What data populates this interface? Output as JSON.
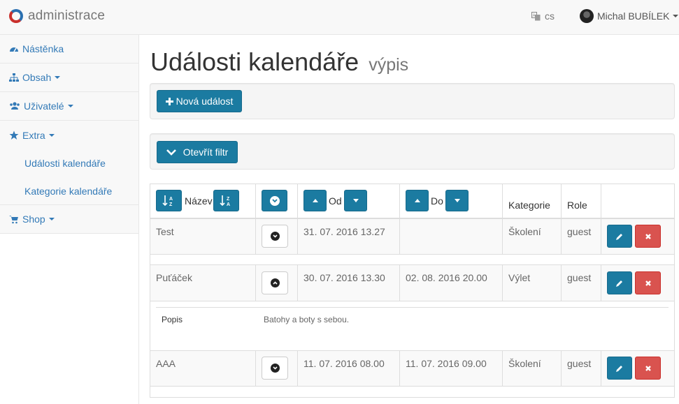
{
  "topbar": {
    "brand": "administrace",
    "language": "cs",
    "user": "Michal BUBÍLEK"
  },
  "sidebar": {
    "items": [
      {
        "label": "Nástěnka",
        "icon": "dashboard-icon"
      },
      {
        "label": "Obsah",
        "icon": "sitemap-icon"
      },
      {
        "label": "Uživatelé",
        "icon": "users-icon"
      },
      {
        "label": "Extra",
        "icon": "star-icon"
      }
    ],
    "extra_sub": [
      "Události kalendáře",
      "Kategorie kalendáře"
    ],
    "shop": {
      "label": "Shop",
      "icon": "cart-icon"
    }
  },
  "page": {
    "title": "Události kalendáře",
    "subtitle": "výpis"
  },
  "toolbar": {
    "new_event_label": "Nová událost",
    "open_filter_label": "Otevřít filtr"
  },
  "table": {
    "headers": {
      "name": "Název",
      "from": "Od",
      "to": "Do",
      "category": "Kategorie",
      "role": "Role"
    },
    "rows": [
      {
        "name": "Test",
        "from": "31. 07. 2016 13.27",
        "to": "",
        "category": "Školení",
        "role": "guest",
        "expanded": false
      },
      {
        "name": "Puťáček",
        "from": "30. 07. 2016 13.30",
        "to": "02. 08. 2016 20.00",
        "category": "Výlet",
        "role": "guest",
        "expanded": true
      },
      {
        "name": "AAA",
        "from": "11. 07. 2016 08.00",
        "to": "11. 07. 2016 09.00",
        "category": "Školení",
        "role": "guest",
        "expanded": false
      }
    ],
    "detail": {
      "key": "Popis",
      "value": "Batohy a boty s sebou."
    }
  },
  "colors": {
    "primary": "#1b7ba1",
    "danger": "#d9534f",
    "link": "#337ab7"
  }
}
